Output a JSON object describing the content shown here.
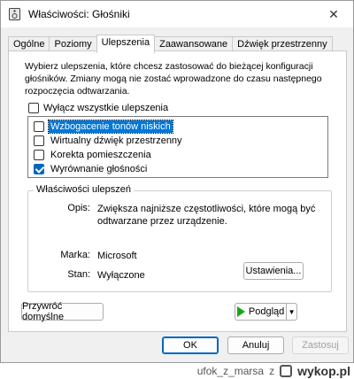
{
  "window": {
    "title": "Właściwości: Głośniki",
    "close_glyph": "✕"
  },
  "tabs": [
    {
      "label": "Ogólne",
      "active": false
    },
    {
      "label": "Poziomy",
      "active": false
    },
    {
      "label": "Ulepszenia",
      "active": true
    },
    {
      "label": "Zaawansowane",
      "active": false
    },
    {
      "label": "Dźwięk przestrzenny",
      "active": false
    }
  ],
  "panel": {
    "description": "Wybierz ulepszenia, które chcesz zastosować do bieżącej konfiguracji głośników. Zmiany mogą nie zostać wprowadzone do czasu następnego rozpoczęcia odtwarzania.",
    "disable_all": {
      "label": "Wyłącz wszystkie ulepszenia",
      "checked": false
    },
    "enhancements": [
      {
        "label": "Wzbogacenie tonów niskich",
        "checked": false,
        "selected": true
      },
      {
        "label": "Wirtualny dźwięk przestrzenny",
        "checked": false,
        "selected": false
      },
      {
        "label": "Korekta pomieszczenia",
        "checked": false,
        "selected": false
      },
      {
        "label": "Wyrównanie głośności",
        "checked": true,
        "selected": false
      }
    ],
    "properties": {
      "group_title": "Właściwości ulepszeń",
      "description_label": "Opis:",
      "description_value": "Zwiększa najniższe częstotliwości, które mogą być odtwarzane przez urządzenie.",
      "brand_label": "Marka:",
      "brand_value": "Microsoft",
      "state_label": "Stan:",
      "state_value": "Wyłączone",
      "settings_button": "Ustawienia..."
    },
    "restore_button": "Przywróć domyślne",
    "preview_button": "Podgląd"
  },
  "dialog_buttons": {
    "ok": "OK",
    "cancel": "Anuluj",
    "apply": "Zastosuj"
  },
  "watermark": {
    "user": "ufok_z_marsa",
    "z": "z",
    "site": "wykop.pl"
  },
  "colors": {
    "accent": "#0067c0",
    "selection": "#0078d7",
    "play_green": "#1aa61a"
  }
}
